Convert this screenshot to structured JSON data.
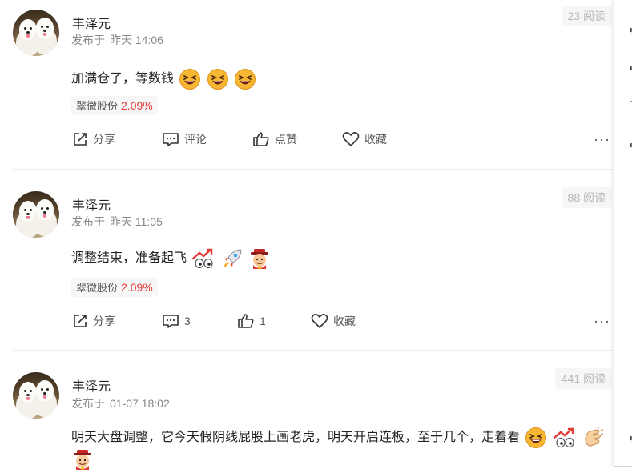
{
  "posts": [
    {
      "author": "丰泽元",
      "published_prefix": "发布于",
      "published_time": "昨天 14:06",
      "reads": "23 阅读",
      "content": "加满仓了，等数钱",
      "emojis": [
        "grin-squint-emoji",
        "grin-squint-emoji",
        "grin-squint-emoji"
      ],
      "stock_name": "翠微股份",
      "stock_change": "2.09%",
      "actions": {
        "share": "分享",
        "comment": "评论",
        "like": "点赞",
        "favorite": "收藏"
      }
    },
    {
      "author": "丰泽元",
      "published_prefix": "发布于",
      "published_time": "昨天 11:05",
      "reads": "88 阅读",
      "content": "调整结束，准备起飞",
      "emojis": [
        "rising-eyes-emoji",
        "rocket-emoji",
        "fortune-god-emoji"
      ],
      "stock_name": "翠微股份",
      "stock_change": "2.09%",
      "actions": {
        "share": "分享",
        "comment": "3",
        "like": "1",
        "favorite": "收藏"
      }
    },
    {
      "author": "丰泽元",
      "published_prefix": "发布于",
      "published_time": "01-07 18:02",
      "reads": "441 阅读",
      "content": "明天大盘调整，它今天假阴线屁股上画老虎，明天开启连板，至于几个，走着看",
      "emojis": [
        "grin-squint-emoji",
        "rising-eyes-emoji",
        "clap-emoji",
        "fortune-god-emoji"
      ]
    }
  ],
  "colors": {
    "accent_red": "#e53935",
    "muted": "#888888",
    "divider": "#ededed"
  },
  "more_label": "···"
}
